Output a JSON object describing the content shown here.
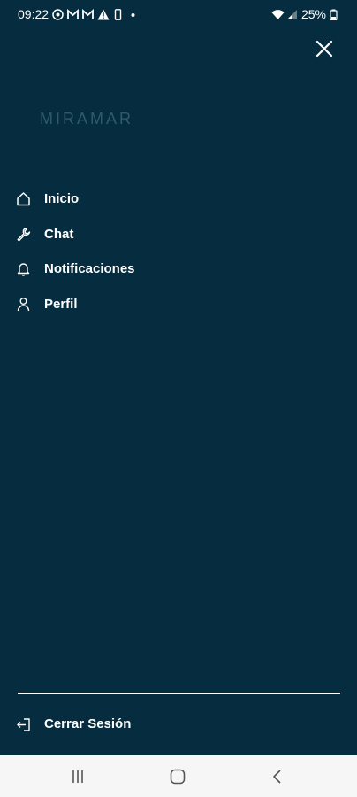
{
  "status_bar": {
    "time": "09:22",
    "battery": "25%",
    "left_icons": [
      "whatsapp-icon",
      "gmail-icon",
      "gmail-icon",
      "alert-icon",
      "phone-icon",
      "dot-icon"
    ],
    "right_icons": [
      "wifi-icon",
      "signal-icon",
      "battery-icon"
    ]
  },
  "header": {
    "close_icon": "close-icon"
  },
  "logo": {
    "text": "MIRAMAR",
    "color": "#2f5c6b"
  },
  "menu": {
    "items": [
      {
        "label": "Inicio",
        "icon": "home-icon"
      },
      {
        "label": "Chat",
        "icon": "wrench-icon"
      },
      {
        "label": "Notificaciones",
        "icon": "bell-icon"
      },
      {
        "label": "Perfil",
        "icon": "user-icon"
      }
    ]
  },
  "footer": {
    "logout_label": "Cerrar Sesión",
    "logout_icon": "logout-icon"
  },
  "nav_bar": {
    "buttons": [
      "recent-apps-icon",
      "home-button-icon",
      "back-icon"
    ]
  },
  "colors": {
    "background": "#062c3f",
    "text": "#ffffff",
    "nav_background": "#f6f6f6"
  }
}
